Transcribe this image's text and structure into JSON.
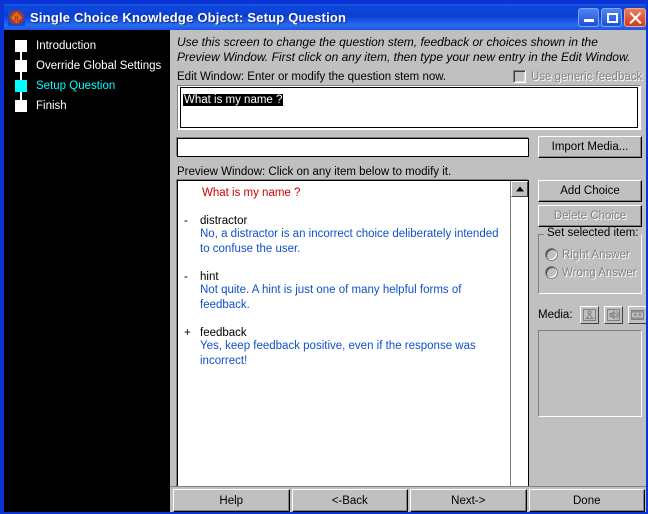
{
  "window": {
    "title": "Single Choice Knowledge Object: Setup Question",
    "icon": "app-diamond-icon",
    "minimize_label": "Minimize",
    "maximize_label": "Maximize",
    "close_label": "Close",
    "accent_titlebar": "#0b3fd4",
    "face_color": "#c0c0c0"
  },
  "sidebar": {
    "steps": [
      {
        "label": "Introduction",
        "current": false
      },
      {
        "label": "Override Global Settings",
        "current": false
      },
      {
        "label": "Setup Question",
        "current": true
      },
      {
        "label": "Finish",
        "current": false
      }
    ],
    "current_color": "#00ffff",
    "background": "#000000"
  },
  "main": {
    "instructions": "Use this screen to change the question stem, feedback or choices shown in the Preview Window. First click on any item, then type your new entry in the Edit Window.",
    "edit_label": "Edit Window: Enter or modify the question stem now.",
    "generic_feedback": {
      "label": "Use generic feedback",
      "checked": false,
      "disabled": true
    },
    "edit_window": {
      "value": "What is my name ?",
      "selected": true
    },
    "media_field": {
      "value": "",
      "placeholder": ""
    },
    "preview_label": "Preview Window: Click on any item below to modify it.",
    "preview": {
      "stem": "What is my name ?",
      "stem_color": "#d00000",
      "feedback_color": "#1050c8",
      "items": [
        {
          "mark": "-",
          "name": "distractor",
          "feedback": "No, a distractor is an incorrect choice deliberately intended to confuse the user."
        },
        {
          "mark": "-",
          "name": "hint",
          "feedback": "Not quite. A hint is just one of many helpful forms of feedback."
        },
        {
          "mark": "+",
          "name": "feedback",
          "feedback": "Yes, keep feedback positive, even if the response was incorrect!"
        }
      ]
    },
    "buttons": {
      "import_media": {
        "label": "Import Media...",
        "disabled": false
      },
      "add_choice": {
        "label": "Add Choice",
        "disabled": false
      },
      "delete_choice": {
        "label": "Delete Choice",
        "disabled": true
      }
    },
    "set_selected_item": {
      "title": "Set selected item:",
      "options": [
        {
          "label": "Right Answer",
          "selected": false,
          "disabled": true
        },
        {
          "label": "Wrong Answer",
          "selected": false,
          "disabled": true
        }
      ]
    },
    "media": {
      "label": "Media:",
      "buttons": [
        {
          "icon": "image-icon",
          "disabled": true
        },
        {
          "icon": "audio-icon",
          "disabled": true
        },
        {
          "icon": "video-icon",
          "disabled": true
        }
      ]
    }
  },
  "footer": {
    "buttons": [
      {
        "label": "Help"
      },
      {
        "label": "<-Back"
      },
      {
        "label": "Next->"
      },
      {
        "label": "Done"
      }
    ]
  }
}
